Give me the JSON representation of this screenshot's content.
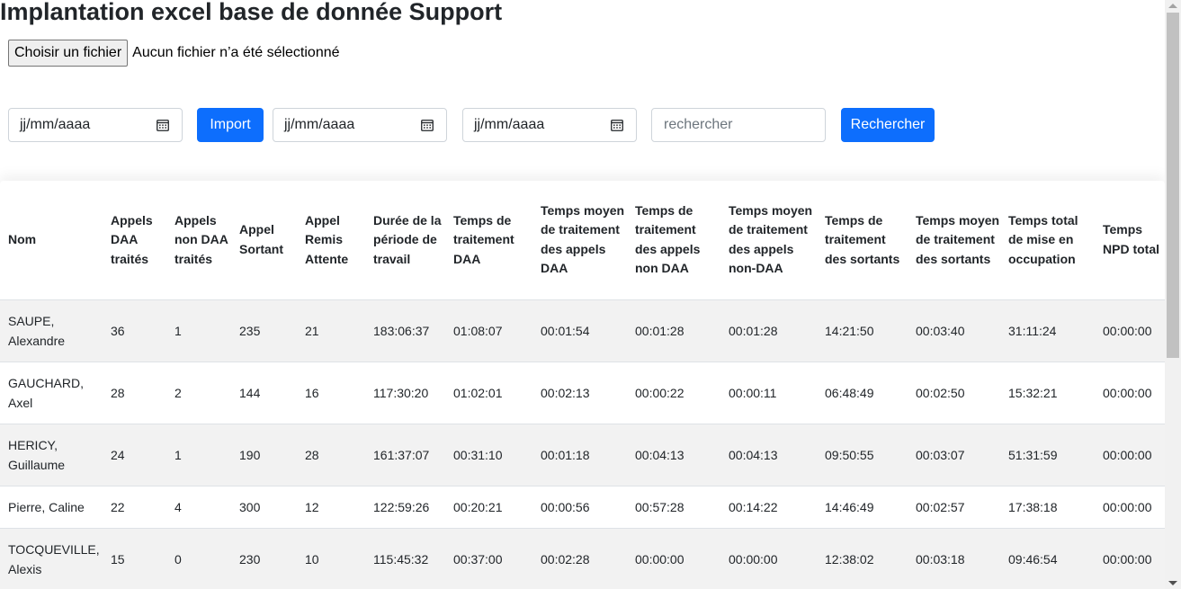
{
  "title": "Implantation excel base de donnée Support",
  "file": {
    "button_label": "Choisir un fichier",
    "status": "Aucun fichier n’a été sélectionné"
  },
  "controls": {
    "date1_placeholder": "jj/mm/aaaa",
    "import_label": "Import",
    "date2_placeholder": "jj/mm/aaaa",
    "date3_placeholder": "jj/mm/aaaa",
    "search_placeholder": "rechercher",
    "search_button_label": "Rechercher"
  },
  "table": {
    "headers": [
      "Nom",
      "Appels DAA traités",
      "Appels non DAA traités",
      "Appel Sortant",
      "Appel Remis Attente",
      "Durée de la période de travail",
      "Temps de traitement DAA",
      "Temps moyen de traitement des appels DAA",
      "Temps de traitement des appels non DAA",
      "Temps moyen de traitement des appels non-DAA",
      "Temps de traitement des sortants",
      "Temps moyen de traitement des sortants",
      "Temps total de mise en occupation",
      "Temps NPD total"
    ],
    "rows": [
      [
        "SAUPE, Alexandre",
        "36",
        "1",
        "235",
        "21",
        "183:06:37",
        "01:08:07",
        "00:01:54",
        "00:01:28",
        "00:01:28",
        "14:21:50",
        "00:03:40",
        "31:11:24",
        "00:00:00"
      ],
      [
        "GAUCHARD, Axel",
        "28",
        "2",
        "144",
        "16",
        "117:30:20",
        "01:02:01",
        "00:02:13",
        "00:00:22",
        "00:00:11",
        "06:48:49",
        "00:02:50",
        "15:32:21",
        "00:00:00"
      ],
      [
        "HERICY, Guillaume",
        "24",
        "1",
        "190",
        "28",
        "161:37:07",
        "00:31:10",
        "00:01:18",
        "00:04:13",
        "00:04:13",
        "09:50:55",
        "00:03:07",
        "51:31:59",
        "00:00:00"
      ],
      [
        "Pierre, Caline",
        "22",
        "4",
        "300",
        "12",
        "122:59:26",
        "00:20:21",
        "00:00:56",
        "00:57:28",
        "00:14:22",
        "14:46:49",
        "00:02:57",
        "17:38:18",
        "00:00:00"
      ],
      [
        "TOCQUEVILLE, Alexis",
        "15",
        "0",
        "230",
        "10",
        "115:45:32",
        "00:37:00",
        "00:02:28",
        "00:00:00",
        "00:00:00",
        "12:38:02",
        "00:03:18",
        "09:46:54",
        "00:00:00"
      ]
    ]
  },
  "colors": {
    "primary": "#0d6efd",
    "stripe": "#f2f2f2",
    "text": "#212529"
  }
}
